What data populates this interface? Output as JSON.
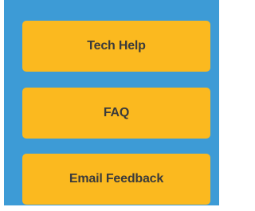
{
  "colors": {
    "panel_background": "#3d9bd6",
    "button_background": "#fbb91f",
    "button_text": "#3b3b3b"
  },
  "buttons": [
    {
      "label": "Tech Help"
    },
    {
      "label": "FAQ"
    },
    {
      "label": "Email Feedback"
    }
  ]
}
